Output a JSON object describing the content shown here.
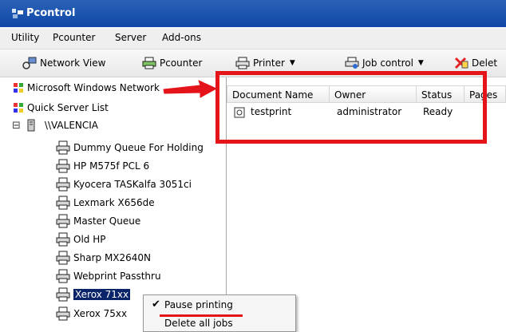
{
  "window": {
    "title": "Pcontrol"
  },
  "menubar": {
    "items": [
      "Utility",
      "Pcounter",
      "Server",
      "Add-ons"
    ]
  },
  "toolbar": {
    "network_view": "Network View",
    "pcounter": "Pcounter",
    "printer": "Printer",
    "job_control": "Job control",
    "delete": "Delet"
  },
  "tree": {
    "ms_network": "Microsoft Windows Network",
    "quick_server": "Quick Server List",
    "expander": "⊟",
    "server": "\\\\VALENCIA",
    "printers": [
      "Dummy Queue For Holding",
      "HP M575f PCL 6",
      "Kyocera TASKalfa 3051ci",
      "Lexmark X656de",
      "Master Queue",
      "Old HP",
      "Sharp MX2640N",
      "Webprint Passthru",
      "Xerox 71xx",
      "Xerox 75xx"
    ],
    "selected_index": 8
  },
  "jobs": {
    "columns": [
      "Document Name",
      "Owner",
      "Status",
      "Pages"
    ],
    "rows": [
      {
        "document": "testprint",
        "owner": "administrator",
        "status": "Ready"
      }
    ]
  },
  "context_menu": {
    "checkmark": "✔",
    "items": [
      "Pause printing",
      "Delete all jobs"
    ]
  },
  "colors": {
    "annotation": "#e5141b",
    "titlebar": "#1a50ad",
    "selection": "#0a246a"
  }
}
